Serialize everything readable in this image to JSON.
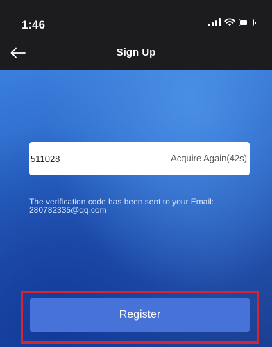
{
  "status_bar": {
    "time": "1:46",
    "icons": [
      "signal-icon",
      "wifi-icon",
      "battery-icon"
    ]
  },
  "nav": {
    "back_icon": "arrow-left-icon",
    "title": "Sign Up"
  },
  "form": {
    "verification_code_value": "511028",
    "acquire_again_label": "Acquire Again(42s)",
    "hint_line_1": "The verification code has been sent to your Email:",
    "hint_line_2": "280782335@qq.com",
    "register_label": "Register"
  },
  "colors": {
    "primary_button": "#4772d8",
    "highlight_border": "#d9242c",
    "background_top": "#3b7fdc",
    "background_bottom": "#1a3f92"
  }
}
